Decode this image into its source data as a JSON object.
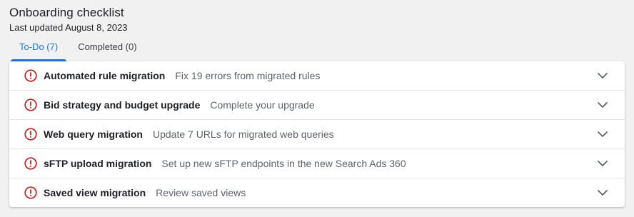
{
  "header": {
    "title": "Onboarding checklist",
    "subtitle": "Last updated August 8, 2023"
  },
  "tabs": [
    {
      "label": "To-Do (7)",
      "active": true
    },
    {
      "label": "Completed (0)",
      "active": false
    }
  ],
  "items": [
    {
      "title": "Automated rule migration",
      "description": "Fix 19 errors from migrated rules",
      "status_icon": "error-icon",
      "expand_icon": "chevron-down-icon"
    },
    {
      "title": "Bid strategy and budget upgrade",
      "description": "Complete your upgrade",
      "status_icon": "error-icon",
      "expand_icon": "chevron-down-icon"
    },
    {
      "title": "Web query migration",
      "description": "Update 7 URLs for migrated web queries",
      "status_icon": "error-icon",
      "expand_icon": "chevron-down-icon"
    },
    {
      "title": "sFTP upload migration",
      "description": "Set up new sFTP endpoints in the new Search Ads 360",
      "status_icon": "error-icon",
      "expand_icon": "chevron-down-icon"
    },
    {
      "title": "Saved view migration",
      "description": "Review saved views",
      "status_icon": "error-icon",
      "expand_icon": "chevron-down-icon"
    }
  ],
  "colors": {
    "accent": "#1a73e8",
    "error": "#c5221f",
    "background": "#f1f1f1"
  }
}
